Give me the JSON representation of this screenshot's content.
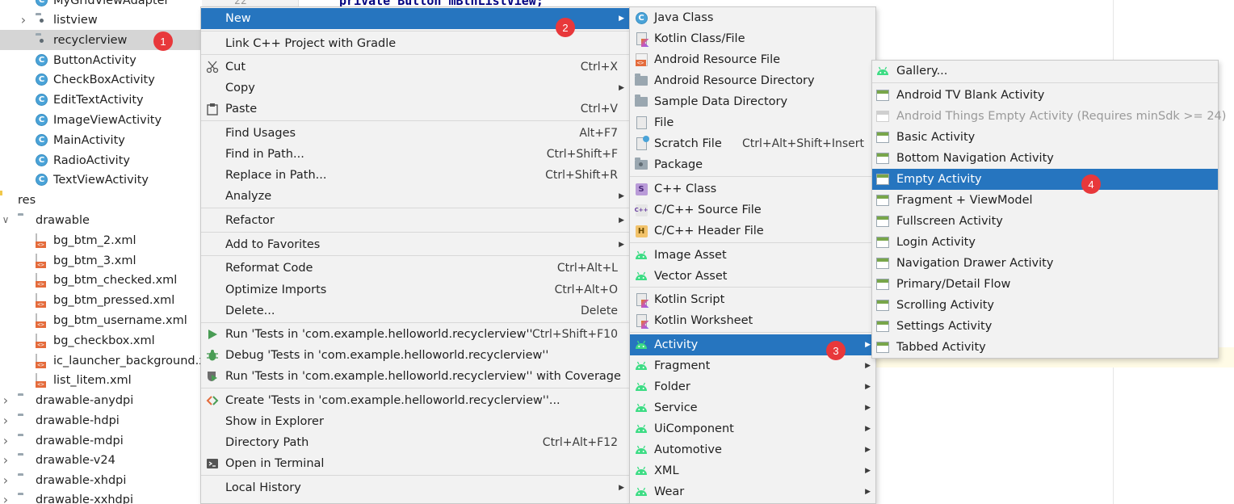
{
  "code": {
    "line_number": "22",
    "line_text": "private Button mBtnListView;"
  },
  "tree": {
    "items": [
      {
        "label": "MyGridViewAdapter",
        "icon": "class-icon"
      },
      {
        "label": "listview",
        "icon": "package-icon"
      },
      {
        "label": "recyclerview",
        "icon": "package-icon",
        "selected": true
      },
      {
        "label": "ButtonActivity",
        "icon": "class-icon"
      },
      {
        "label": "CheckBoxActivity",
        "icon": "class-icon"
      },
      {
        "label": "EditTextActivity",
        "icon": "class-icon"
      },
      {
        "label": "ImageViewActivity",
        "icon": "class-icon"
      },
      {
        "label": "MainActivity",
        "icon": "class-icon"
      },
      {
        "label": "RadioActivity",
        "icon": "class-icon"
      },
      {
        "label": "TextViewActivity",
        "icon": "class-icon"
      },
      {
        "label": "res",
        "icon": "res-folder-icon"
      },
      {
        "label": "drawable",
        "icon": "folder-icon"
      },
      {
        "label": "bg_btm_2.xml",
        "icon": "xml-file-icon"
      },
      {
        "label": "bg_btm_3.xml",
        "icon": "xml-file-icon"
      },
      {
        "label": "bg_btm_checked.xml",
        "icon": "xml-file-icon"
      },
      {
        "label": "bg_btm_pressed.xml",
        "icon": "xml-file-icon"
      },
      {
        "label": "bg_btm_username.xml",
        "icon": "xml-file-icon"
      },
      {
        "label": "bg_checkbox.xml",
        "icon": "xml-file-icon"
      },
      {
        "label": "ic_launcher_background.xml",
        "icon": "xml-file-icon"
      },
      {
        "label": "list_litem.xml",
        "icon": "xml-file-icon"
      },
      {
        "label": "drawable-anydpi",
        "icon": "folder-icon"
      },
      {
        "label": "drawable-hdpi",
        "icon": "folder-icon"
      },
      {
        "label": "drawable-mdpi",
        "icon": "folder-icon"
      },
      {
        "label": "drawable-v24",
        "icon": "folder-icon"
      },
      {
        "label": "drawable-xhdpi",
        "icon": "folder-icon"
      },
      {
        "label": "drawable-xxhdpi",
        "icon": "folder-icon"
      }
    ]
  },
  "context_menu": {
    "items": [
      {
        "label": "New",
        "shortcut": "",
        "submenu": true,
        "highlighted": true
      },
      {
        "label": "Link C++ Project with Gradle",
        "shortcut": ""
      },
      {
        "label": "Cut",
        "shortcut": "Ctrl+X",
        "icon": "scissors-icon"
      },
      {
        "label": "Copy",
        "shortcut": "",
        "submenu": true
      },
      {
        "label": "Paste",
        "shortcut": "Ctrl+V",
        "icon": "clipboard-icon"
      },
      {
        "label": "Find Usages",
        "shortcut": "Alt+F7"
      },
      {
        "label": "Find in Path...",
        "shortcut": "Ctrl+Shift+F"
      },
      {
        "label": "Replace in Path...",
        "shortcut": "Ctrl+Shift+R"
      },
      {
        "label": "Analyze",
        "shortcut": "",
        "submenu": true
      },
      {
        "label": "Refactor",
        "shortcut": "",
        "submenu": true
      },
      {
        "label": "Add to Favorites",
        "shortcut": "",
        "submenu": true
      },
      {
        "label": "Reformat Code",
        "shortcut": "Ctrl+Alt+L"
      },
      {
        "label": "Optimize Imports",
        "shortcut": "Ctrl+Alt+O"
      },
      {
        "label": "Delete...",
        "shortcut": "Delete"
      },
      {
        "label": "Run 'Tests in 'com.example.helloworld.recyclerview''",
        "shortcut": "Ctrl+Shift+F10",
        "icon": "run-icon"
      },
      {
        "label": "Debug 'Tests in 'com.example.helloworld.recyclerview''",
        "shortcut": "",
        "icon": "debug-icon"
      },
      {
        "label": "Run 'Tests in 'com.example.helloworld.recyclerview'' with Coverage",
        "shortcut": "",
        "icon": "coverage-icon"
      },
      {
        "label": "Create 'Tests in 'com.example.helloworld.recyclerview''...",
        "shortcut": "",
        "icon": "create-test-icon"
      },
      {
        "label": "Show in Explorer",
        "shortcut": ""
      },
      {
        "label": "Directory Path",
        "shortcut": "Ctrl+Alt+F12"
      },
      {
        "label": "Open in Terminal",
        "shortcut": "",
        "icon": "terminal-icon"
      },
      {
        "label": "Local History",
        "shortcut": "",
        "submenu": true
      }
    ]
  },
  "new_menu": {
    "items": [
      {
        "label": "Java Class",
        "shortcut": "",
        "icon": "java-class-icon"
      },
      {
        "label": "Kotlin Class/File",
        "shortcut": "",
        "icon": "kotlin-file-icon"
      },
      {
        "label": "Android Resource File",
        "shortcut": "",
        "icon": "android-resource-file-icon"
      },
      {
        "label": "Android Resource Directory",
        "shortcut": "",
        "icon": "folder-icon"
      },
      {
        "label": "Sample Data Directory",
        "shortcut": "",
        "icon": "folder-icon"
      },
      {
        "label": "File",
        "shortcut": "",
        "icon": "file-icon"
      },
      {
        "label": "Scratch File",
        "shortcut": "Ctrl+Alt+Shift+Insert",
        "icon": "scratch-file-icon"
      },
      {
        "label": "Package",
        "shortcut": "",
        "icon": "package-icon"
      },
      {
        "label": "C++ Class",
        "shortcut": "",
        "icon": "cpp-class-icon"
      },
      {
        "label": "C/C++ Source File",
        "shortcut": "",
        "icon": "cpp-source-icon"
      },
      {
        "label": "C/C++ Header File",
        "shortcut": "",
        "icon": "cpp-header-icon"
      },
      {
        "label": "Image Asset",
        "shortcut": "",
        "icon": "android-icon"
      },
      {
        "label": "Vector Asset",
        "shortcut": "",
        "icon": "android-icon"
      },
      {
        "label": "Kotlin Script",
        "shortcut": "",
        "icon": "kotlin-script-icon"
      },
      {
        "label": "Kotlin Worksheet",
        "shortcut": "",
        "icon": "kotlin-worksheet-icon"
      },
      {
        "label": "Activity",
        "shortcut": "",
        "icon": "android-icon",
        "submenu": true,
        "highlighted": true
      },
      {
        "label": "Fragment",
        "shortcut": "",
        "icon": "android-icon",
        "submenu": true
      },
      {
        "label": "Folder",
        "shortcut": "",
        "icon": "android-icon",
        "submenu": true
      },
      {
        "label": "Service",
        "shortcut": "",
        "icon": "android-icon",
        "submenu": true
      },
      {
        "label": "UiComponent",
        "shortcut": "",
        "icon": "android-icon",
        "submenu": true
      },
      {
        "label": "Automotive",
        "shortcut": "",
        "icon": "android-icon",
        "submenu": true
      },
      {
        "label": "XML",
        "shortcut": "",
        "icon": "android-icon",
        "submenu": true
      },
      {
        "label": "Wear",
        "shortcut": "",
        "icon": "android-icon",
        "submenu": true
      }
    ]
  },
  "activity_menu": {
    "items": [
      {
        "label": "Gallery...",
        "icon": "android-icon"
      },
      {
        "label": "Android TV Blank Activity",
        "icon": "template-icon"
      },
      {
        "label": "Android Things Empty Activity (Requires minSdk >= 24)",
        "icon": "template-icon",
        "disabled": true
      },
      {
        "label": "Basic Activity",
        "icon": "template-icon"
      },
      {
        "label": "Bottom Navigation Activity",
        "icon": "template-icon"
      },
      {
        "label": "Empty Activity",
        "icon": "template-icon",
        "highlighted": true
      },
      {
        "label": "Fragment + ViewModel",
        "icon": "template-icon"
      },
      {
        "label": "Fullscreen Activity",
        "icon": "template-icon"
      },
      {
        "label": "Login Activity",
        "icon": "template-icon"
      },
      {
        "label": "Navigation Drawer Activity",
        "icon": "template-icon"
      },
      {
        "label": "Primary/Detail Flow",
        "icon": "template-icon"
      },
      {
        "label": "Scrolling Activity",
        "icon": "template-icon"
      },
      {
        "label": "Settings Activity",
        "icon": "template-icon"
      },
      {
        "label": "Tabbed Activity",
        "icon": "template-icon"
      }
    ]
  },
  "badges": [
    "1",
    "2",
    "3",
    "4"
  ],
  "colors": {
    "highlight": "#2675bf",
    "badge": "#e8383b",
    "android_green": "#3ddc84"
  }
}
